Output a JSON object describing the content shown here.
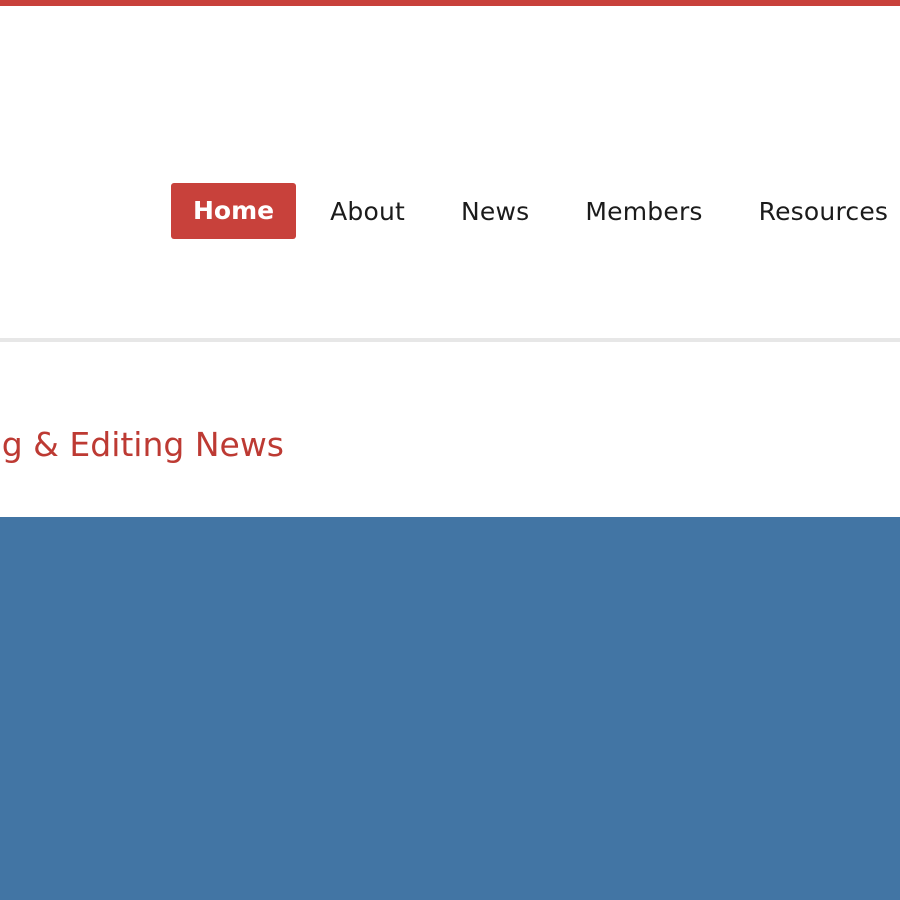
{
  "nav": {
    "items": [
      {
        "label": "Home",
        "active": true
      },
      {
        "label": "About",
        "active": false
      },
      {
        "label": "News",
        "active": false
      },
      {
        "label": "Members",
        "active": false
      },
      {
        "label": "Resources",
        "active": false
      }
    ]
  },
  "tagline": "ng & Editing News",
  "colors": {
    "accent": "#c8413b",
    "tagline": "#bd3a33",
    "hero_background": "#4275a4",
    "divider": "#e7e7e7"
  }
}
